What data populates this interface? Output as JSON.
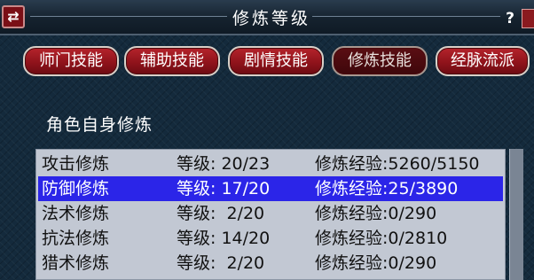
{
  "window": {
    "title": "修炼等级",
    "left_icon": "⇄",
    "help_label": "?"
  },
  "tabs": [
    {
      "label": "师门技能",
      "active": false
    },
    {
      "label": "辅助技能",
      "active": false
    },
    {
      "label": "剧情技能",
      "active": false
    },
    {
      "label": "修炼技能",
      "active": true
    },
    {
      "label": "经脉流派",
      "active": false
    }
  ],
  "section": {
    "title": "角色自身修炼"
  },
  "cultivation_list": {
    "selected_index": 1,
    "rows": [
      {
        "name": "攻击修炼",
        "level": "等级: 20/23",
        "exp": "修炼经验:5260/5150"
      },
      {
        "name": "防御修炼",
        "level": "等级: 17/20",
        "exp": "修炼经验:25/3890"
      },
      {
        "name": "法术修炼",
        "level": "等级:  2/20",
        "exp": "修炼经验:0/290"
      },
      {
        "name": "抗法修炼",
        "level": "等级: 14/20",
        "exp": "修炼经验:0/2810"
      },
      {
        "name": "猎术修炼",
        "level": "等级:  2/20",
        "exp": "修炼经验:0/290"
      }
    ]
  },
  "colors": {
    "selected_row": "#2b25e8",
    "tab_red": "#b5232c",
    "list_bg": "#c2c8d3"
  }
}
